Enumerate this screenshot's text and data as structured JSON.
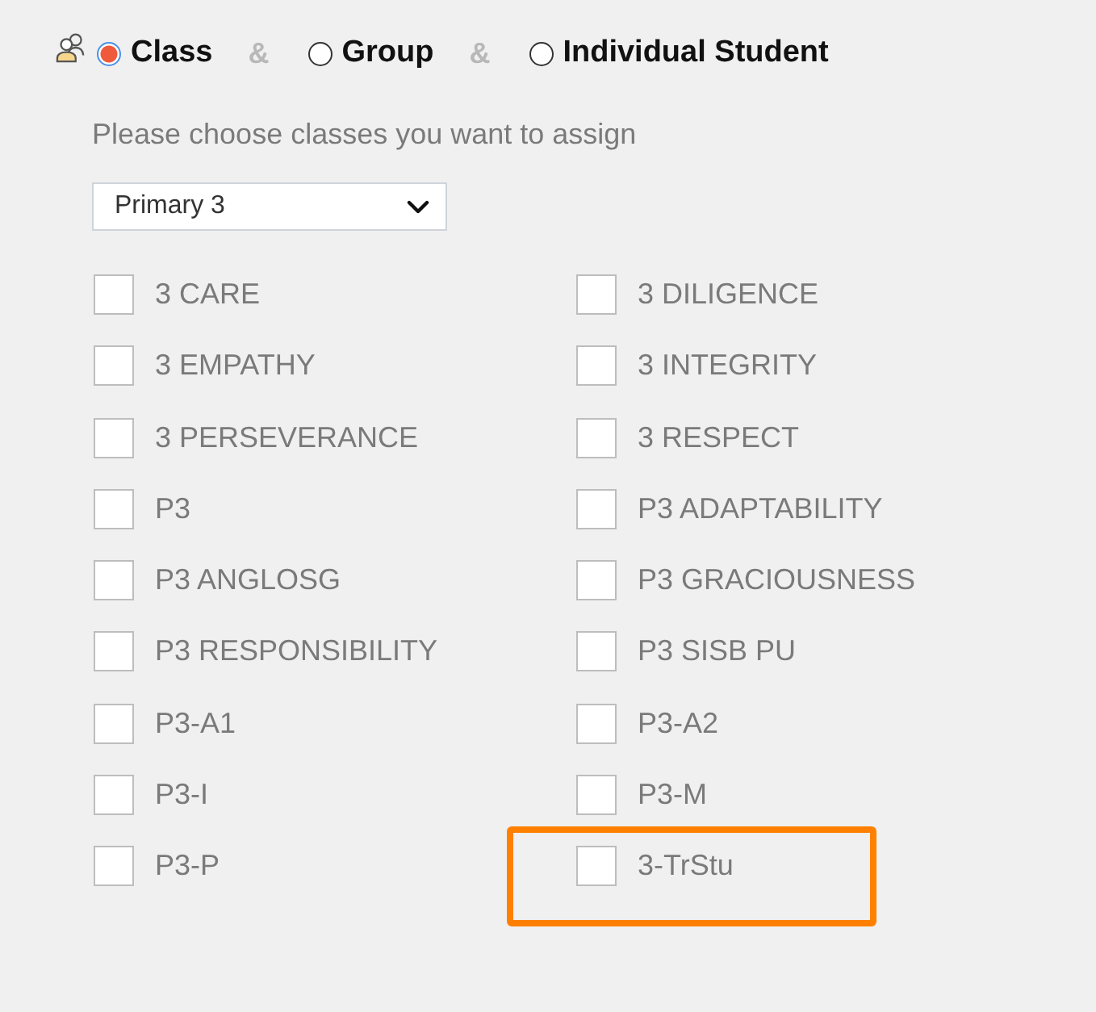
{
  "recipient_type": {
    "options": [
      {
        "label": "Class",
        "selected": true
      },
      {
        "separator": "&",
        "label": "Group",
        "selected": false
      },
      {
        "separator": "&",
        "label": "Individual Student",
        "selected": false
      }
    ]
  },
  "prompt": "Please choose classes you want to assign",
  "level_select": {
    "value": "Primary 3"
  },
  "classes": [
    {
      "label": "3 CARE",
      "checked": false,
      "highlighted": false
    },
    {
      "label": "3 DILIGENCE",
      "checked": false,
      "highlighted": false
    },
    {
      "label": "3 EMPATHY",
      "checked": false,
      "highlighted": false
    },
    {
      "label": "3 INTEGRITY",
      "checked": false,
      "highlighted": false
    },
    {
      "label": "3 PERSEVERANCE",
      "checked": false,
      "highlighted": false
    },
    {
      "label": "3 RESPECT",
      "checked": false,
      "highlighted": false
    },
    {
      "label": "P3",
      "checked": false,
      "highlighted": false
    },
    {
      "label": "P3 ADAPTABILITY",
      "checked": false,
      "highlighted": false
    },
    {
      "label": "P3 ANGLOSG",
      "checked": false,
      "highlighted": false
    },
    {
      "label": "P3 GRACIOUSNESS",
      "checked": false,
      "highlighted": false
    },
    {
      "label": "P3 RESPONSIBILITY",
      "checked": false,
      "highlighted": false
    },
    {
      "label": "P3 SISB PU",
      "checked": false,
      "highlighted": false
    },
    {
      "label": "P3-A1",
      "checked": false,
      "highlighted": false
    },
    {
      "label": "P3-A2",
      "checked": false,
      "highlighted": false
    },
    {
      "label": "P3-I",
      "checked": false,
      "highlighted": false
    },
    {
      "label": "P3-M",
      "checked": false,
      "highlighted": false
    },
    {
      "label": "P3-P",
      "checked": false,
      "highlighted": false
    },
    {
      "label": "3-TrStu",
      "checked": false,
      "highlighted": true
    }
  ]
}
